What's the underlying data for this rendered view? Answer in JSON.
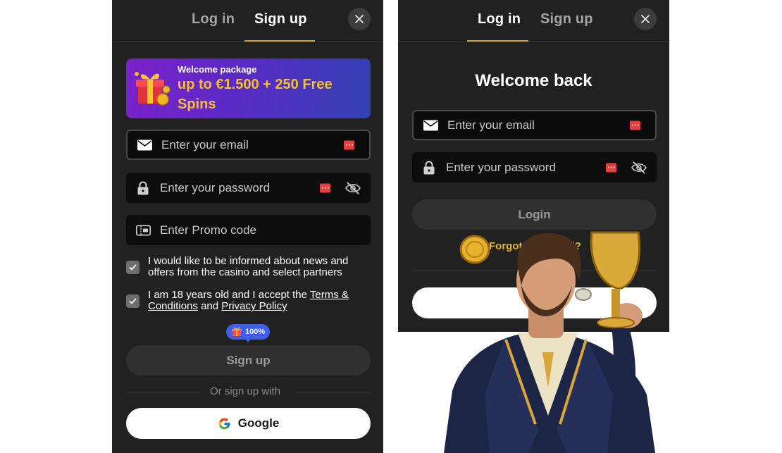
{
  "signup": {
    "tabs": {
      "login": "Log in",
      "signup": "Sign up"
    },
    "banner": {
      "subtitle": "Welcome package",
      "title": "up to €1.500 + 250 Free Spins"
    },
    "fields": {
      "email_placeholder": "Enter your email",
      "password_placeholder": "Enter your password",
      "promo_placeholder": "Enter Promo code"
    },
    "consent_news": "I would like to be informed about news and offers from the casino and select partners",
    "consent_age": {
      "prefix": "I am 18 years old and I accept the",
      "terms_link": "Terms & Conditions",
      "and": "and",
      "privacy_link": "Privacy Policy"
    },
    "progress_badge": "100%",
    "signup_button": "Sign up",
    "or_text": "Or sign up with",
    "google_button": "Google"
  },
  "login": {
    "tabs": {
      "login": "Log in",
      "signup": "Sign up"
    },
    "welcome_title": "Welcome back",
    "fields": {
      "email_placeholder": "Enter your email",
      "password_placeholder": "Enter your password"
    },
    "login_button": "Login",
    "forgot_link": "Forgot password?"
  },
  "colors": {
    "panel_bg": "#212121",
    "accent_gold": "#d7a437",
    "banner_title": "#f5c02a",
    "badge_blue": "#3f5fe8"
  }
}
